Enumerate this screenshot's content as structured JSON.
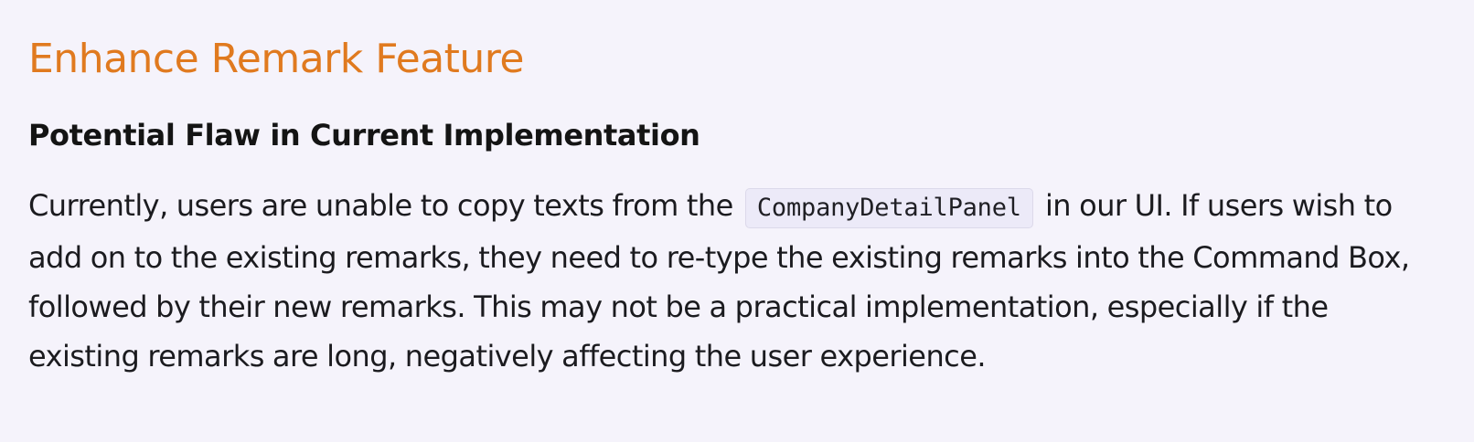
{
  "document": {
    "title": "Enhance Remark Feature",
    "section_heading": "Potential Flaw in Current Implementation",
    "paragraph": {
      "before_code": "Currently, users are unable to copy texts from the",
      "code": "CompanyDetailPanel",
      "after_code": "in our UI. If users wish to add on to the existing remarks, they need to re-type the existing remarks into the Command Box, followed by their new remarks. This may not be a practical implementation, especially if the existing remarks are long, negatively affecting the user experience."
    }
  },
  "colors": {
    "title": "#e07a1f",
    "background": "#f5f3fb",
    "code_background": "#eceaf8"
  }
}
